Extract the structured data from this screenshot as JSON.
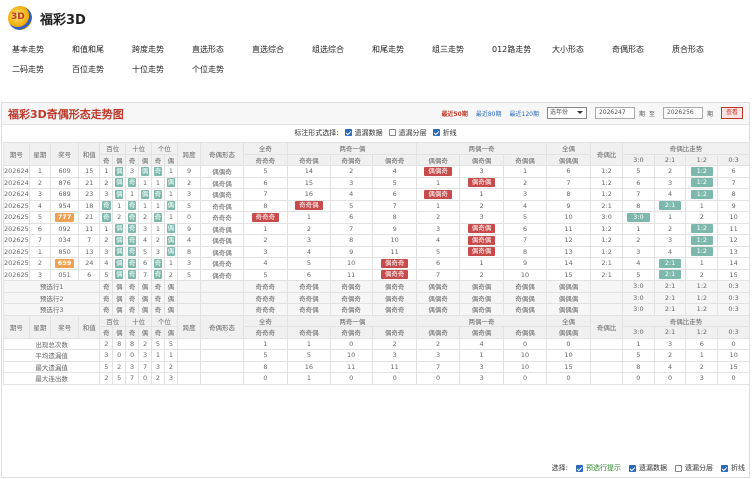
{
  "app": {
    "title": "福彩3D",
    "logo_text": "3D"
  },
  "nav": [
    [
      "基本走势",
      "和值和尾",
      "跨度走势",
      "直选形态",
      "直选综合",
      "组选综合",
      "和尾走势",
      "组三走势",
      "012路走势",
      "大小形态",
      "奇偶形态",
      "质合形态"
    ],
    [
      "二码走势",
      "百位走势",
      "十位走势",
      "个位走势"
    ]
  ],
  "panel": {
    "title": "福彩3D奇偶形态走势图",
    "range_links": [
      "最近50期",
      "最近80期",
      "最近120期"
    ],
    "select": "选年份",
    "from": "2026247",
    "from_unit": "期",
    "to_label": "至",
    "to": "2026256",
    "to_unit": "期",
    "query": "查看"
  },
  "options": {
    "label": "标注形式选择:",
    "items": [
      {
        "label": "遗漏数据",
        "checked": true
      },
      {
        "label": "遗漏分层",
        "checked": false
      },
      {
        "label": "折线",
        "checked": true
      }
    ]
  },
  "header1": [
    "期号",
    "星期",
    "奖号",
    "和值",
    "百位",
    "十位",
    "个位",
    "跨度",
    "奇偶形态",
    "全奇",
    "两奇一偶",
    "两偶一奇",
    "全偶",
    "奇偶比",
    "奇偶比走势"
  ],
  "header2": {
    "digits": [
      "奇",
      "偶",
      "奇",
      "偶",
      "奇",
      "偶"
    ],
    "ratios": [
      "3:0",
      "2:1",
      "1:2",
      "0:3"
    ],
    "shapes": {
      "all_odd": [
        "奇奇奇"
      ],
      "two_odd": [
        "奇奇偶",
        "奇偶奇",
        "偶奇奇"
      ],
      "two_even": [
        "偶偶奇",
        "偶奇偶",
        "奇偶偶"
      ],
      "all_even": [
        "偶偶偶"
      ]
    }
  },
  "rows": [
    {
      "p": "2026247",
      "w": "1",
      "n": "609",
      "s": "15",
      "d": [
        "1",
        "偶",
        "3",
        "偶",
        "奇",
        "1"
      ],
      "k": "9",
      "f": "偶偶奇",
      "c": [
        "5",
        "14",
        "2",
        "4",
        "偶偶奇",
        "3",
        "1",
        "6"
      ],
      "r": "1:2",
      "t": [
        "5",
        "2",
        "1:2",
        "6"
      ]
    },
    {
      "p": "2026248",
      "w": "2",
      "n": "876",
      "s": "21",
      "d": [
        "2",
        "偶",
        "奇",
        "1",
        "1",
        "偶"
      ],
      "k": "2",
      "f": "偶奇偶",
      "c": [
        "6",
        "15",
        "3",
        "5",
        "1",
        "偶奇偶",
        "2",
        "7"
      ],
      "r": "1:2",
      "t": [
        "6",
        "3",
        "1:2",
        "7"
      ]
    },
    {
      "p": "2026249",
      "w": "3",
      "n": "689",
      "s": "23",
      "d": [
        "3",
        "偶",
        "1",
        "偶",
        "奇",
        "1"
      ],
      "k": "3",
      "f": "偶偶奇",
      "c": [
        "7",
        "16",
        "4",
        "6",
        "偶偶奇",
        "1",
        "3",
        "8"
      ],
      "r": "1:2",
      "t": [
        "7",
        "4",
        "1:2",
        "8"
      ]
    },
    {
      "p": "2026250",
      "w": "4",
      "n": "954",
      "s": "18",
      "d": [
        "奇",
        "1",
        "奇",
        "1",
        "1",
        "偶"
      ],
      "k": "5",
      "f": "奇奇偶",
      "c": [
        "8",
        "奇奇偶",
        "5",
        "7",
        "1",
        "2",
        "4",
        "9"
      ],
      "r": "2:1",
      "t": [
        "8",
        "2:1",
        "1",
        "9"
      ]
    },
    {
      "p": "2026251",
      "w": "5",
      "n": "777",
      "s": "21",
      "d": [
        "奇",
        "2",
        "奇",
        "2",
        "奇",
        "1"
      ],
      "k": "0",
      "f": "奇奇奇",
      "c": [
        "奇奇奇",
        "1",
        "6",
        "8",
        "2",
        "3",
        "5",
        "10"
      ],
      "r": "3:0",
      "t": [
        "3:0",
        "1",
        "2",
        "10"
      ]
    },
    {
      "p": "2026252",
      "w": "6",
      "n": "092",
      "s": "11",
      "d": [
        "1",
        "偶",
        "奇",
        "3",
        "1",
        "偶"
      ],
      "k": "9",
      "f": "偶奇偶",
      "c": [
        "1",
        "2",
        "7",
        "9",
        "3",
        "偶奇偶",
        "6",
        "11"
      ],
      "r": "1:2",
      "t": [
        "1",
        "2",
        "1:2",
        "11"
      ]
    },
    {
      "p": "2026253",
      "w": "7",
      "n": "034",
      "s": "7",
      "d": [
        "2",
        "偶",
        "奇",
        "4",
        "2",
        "偶"
      ],
      "k": "4",
      "f": "偶奇偶",
      "c": [
        "2",
        "3",
        "8",
        "10",
        "4",
        "偶奇偶",
        "7",
        "12"
      ],
      "r": "1:2",
      "t": [
        "2",
        "3",
        "1:2",
        "12"
      ]
    },
    {
      "p": "2026254",
      "w": "1",
      "n": "850",
      "s": "13",
      "d": [
        "3",
        "偶",
        "奇",
        "5",
        "3",
        "偶"
      ],
      "k": "8",
      "f": "偶奇偶",
      "c": [
        "3",
        "4",
        "9",
        "11",
        "5",
        "偶奇偶",
        "8",
        "13"
      ],
      "r": "1:2",
      "t": [
        "3",
        "4",
        "1:2",
        "13"
      ]
    },
    {
      "p": "2026255",
      "w": "2",
      "n": "699",
      "s": "24",
      "d": [
        "4",
        "偶",
        "奇",
        "6",
        "奇",
        "1"
      ],
      "k": "3",
      "f": "偶奇奇",
      "c": [
        "4",
        "5",
        "10",
        "偶奇奇",
        "6",
        "1",
        "9",
        "14"
      ],
      "r": "2:1",
      "t": [
        "4",
        "2:1",
        "1",
        "14"
      ]
    },
    {
      "p": "2026256",
      "w": "3",
      "n": "051",
      "s": "6",
      "d": [
        "5",
        "偶",
        "奇",
        "7",
        "奇",
        "2"
      ],
      "k": "5",
      "f": "偶奇奇",
      "c": [
        "5",
        "6",
        "11",
        "偶奇奇",
        "7",
        "2",
        "10",
        "15"
      ],
      "r": "2:1",
      "t": [
        "5",
        "2:1",
        "2",
        "15"
      ]
    }
  ],
  "predict": [
    "预选行1",
    "预选行2",
    "预选行3"
  ],
  "stats": [
    {
      "label": "出现总次数",
      "v": [
        "2",
        "8",
        "8",
        "2",
        "5",
        "5"
      ],
      "c": [
        "1",
        "1",
        "0",
        "2",
        "2",
        "4",
        "0",
        "0"
      ],
      "t": [
        "1",
        "3",
        "6",
        "0"
      ]
    },
    {
      "label": "平均遗漏值",
      "v": [
        "3",
        "0",
        "0",
        "3",
        "1",
        "1"
      ],
      "c": [
        "5",
        "5",
        "10",
        "3",
        "3",
        "1",
        "10",
        "10"
      ],
      "t": [
        "5",
        "2",
        "1",
        "10"
      ]
    },
    {
      "label": "最大遗漏值",
      "v": [
        "5",
        "2",
        "3",
        "7",
        "3",
        "2"
      ],
      "c": [
        "8",
        "16",
        "11",
        "11",
        "7",
        "3",
        "10",
        "15"
      ],
      "t": [
        "8",
        "4",
        "2",
        "15"
      ]
    },
    {
      "label": "最大连出数",
      "v": [
        "2",
        "5",
        "7",
        "0",
        "2",
        "3"
      ],
      "c": [
        "0",
        "1",
        "0",
        "0",
        "0",
        "3",
        "0",
        "0"
      ],
      "t": [
        "0",
        "0",
        "3",
        "0"
      ]
    }
  ],
  "footer": {
    "label": "选择:",
    "items": [
      {
        "label": "预选行提示",
        "checked": true
      },
      {
        "label": "遗漏数据",
        "checked": true
      },
      {
        "label": "遗漏分层",
        "checked": false
      },
      {
        "label": "折线",
        "checked": true
      }
    ]
  },
  "colors": {
    "accent": "#c0392b",
    "orange": "#f0a050",
    "teal": "#7db8ad",
    "link": "#2a6ab8"
  }
}
